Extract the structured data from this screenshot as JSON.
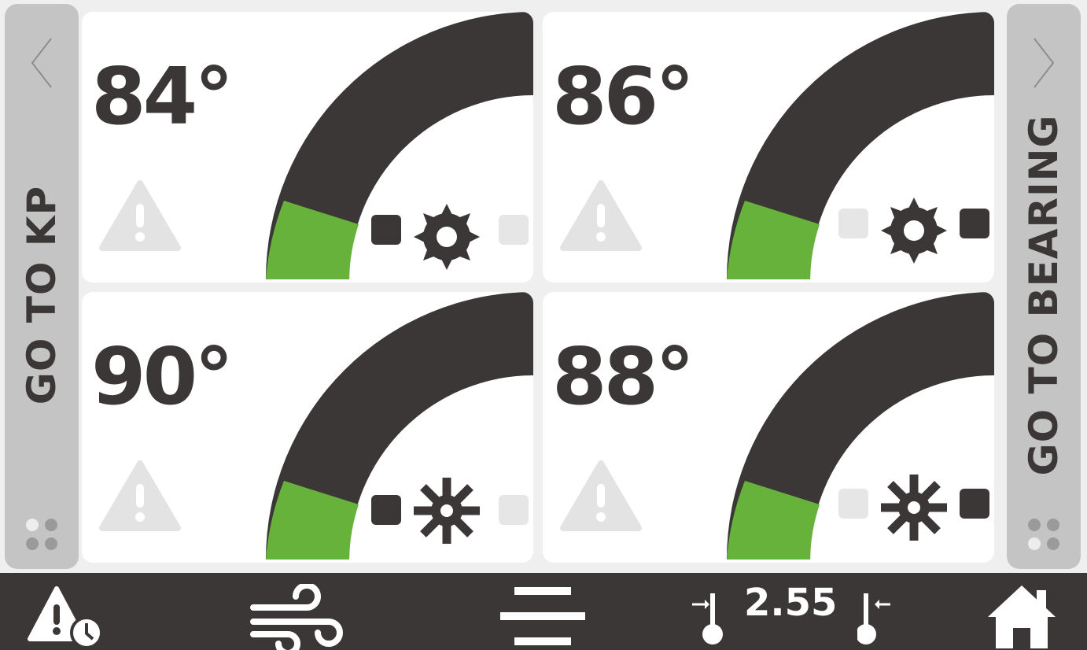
{
  "nav": {
    "left_label": "GO TO KP",
    "right_label": "GO TO BEARING",
    "left_icon": "chevron-left-icon",
    "right_icon": "chevron-right-icon"
  },
  "tiles": [
    {
      "temp": "84°",
      "gauge_fraction": 0.2,
      "fan": "gear-fan-icon",
      "left_indicator": "on",
      "right_indicator": "off"
    },
    {
      "temp": "86°",
      "gauge_fraction": 0.2,
      "fan": "gear-fan-icon",
      "left_indicator": "off",
      "right_indicator": "on"
    },
    {
      "temp": "90°",
      "gauge_fraction": 0.2,
      "fan": "snowflake-fan-icon",
      "left_indicator": "on",
      "right_indicator": "off"
    },
    {
      "temp": "88°",
      "gauge_fraction": 0.2,
      "fan": "snowflake-fan-icon",
      "left_indicator": "off",
      "right_indicator": "on"
    }
  ],
  "bottom_bar": {
    "alarm_history_icon": "warning-clock-icon",
    "wind_icon": "wind-icon",
    "menu_icon": "menu-icon",
    "ratio_value": "2.55",
    "home_icon": "home-icon"
  },
  "colors": {
    "dark": "#3b3737",
    "green": "#66b23b",
    "side_panel": "#c4c4c4",
    "warning_gray": "#e3e3e3"
  }
}
